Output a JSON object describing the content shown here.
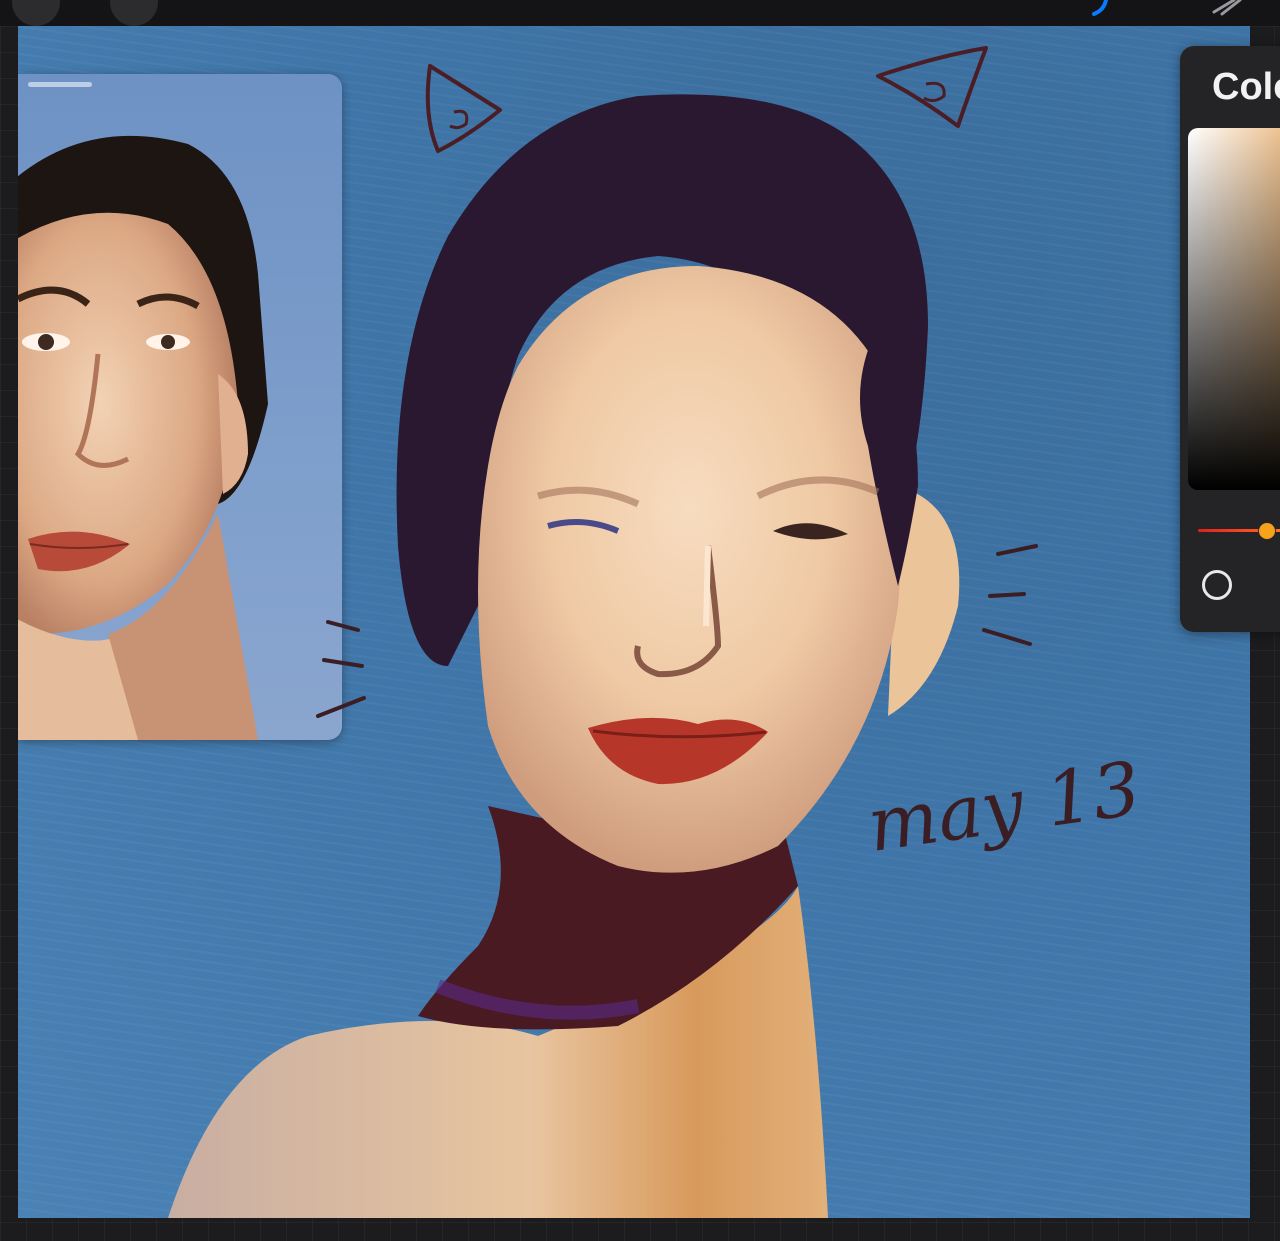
{
  "panel": {
    "title": "Colo"
  },
  "canvas": {
    "signature": "may 13"
  },
  "toolbar": {
    "left_tools": [
      "gallery-icon",
      "adjustments-icon"
    ],
    "right_tools": [
      "brush-icon",
      "smudge-icon"
    ]
  },
  "colors": {
    "accent": "#0a7aff",
    "background": "#3f75a8",
    "selected_hue": "#f7a21b"
  }
}
